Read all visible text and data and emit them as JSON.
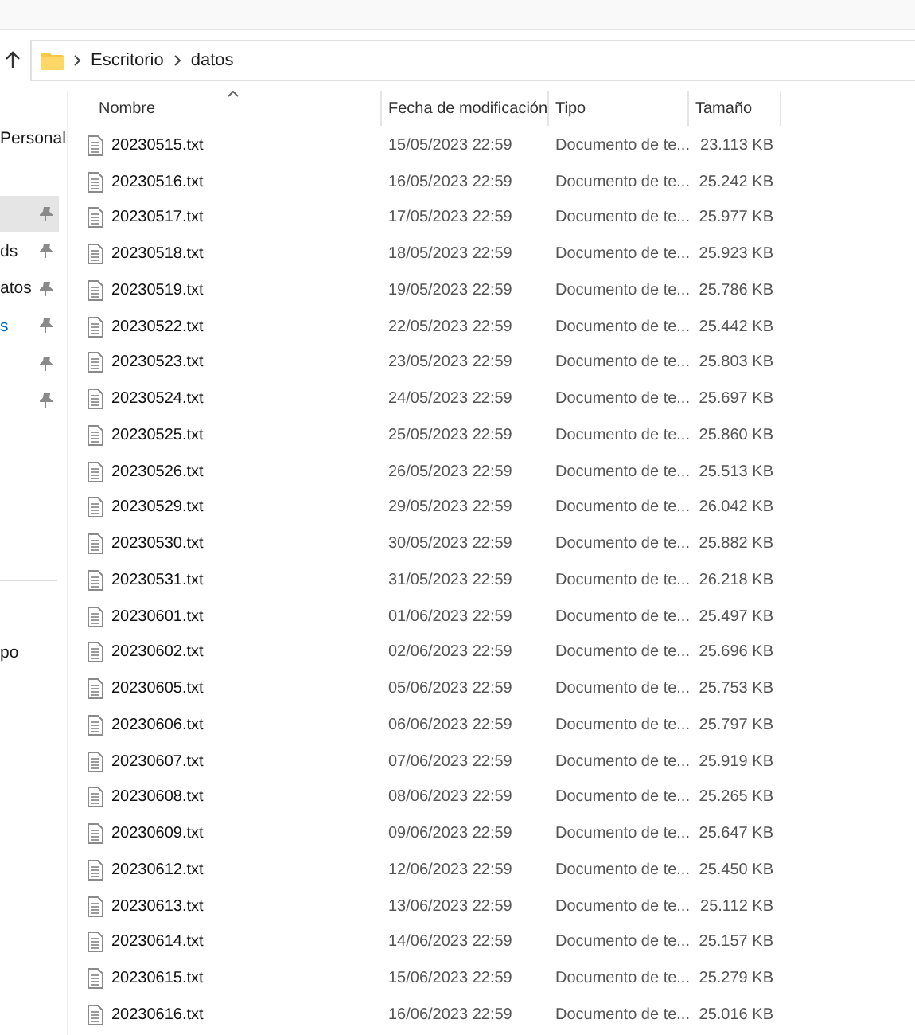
{
  "address": {
    "path": [
      "Escritorio",
      "datos"
    ]
  },
  "sidebar": {
    "groups": [
      {
        "items": [
          {
            "label": "Personal",
            "kind": "text",
            "pinned": false,
            "selected": false
          }
        ]
      },
      {
        "items": [
          {
            "pinned": true,
            "selected": true
          },
          {
            "label": "ds",
            "kind": "text",
            "pinned": true,
            "selected": false
          },
          {
            "label": "atos",
            "kind": "text",
            "pinned": true,
            "selected": false
          },
          {
            "label": "s",
            "kind": "accent",
            "pinned": true,
            "selected": false
          },
          {
            "pinned": true,
            "selected": false
          },
          {
            "pinned": true,
            "selected": false
          }
        ]
      },
      {
        "items": [
          {
            "label": "po",
            "kind": "text",
            "pinned": false,
            "selected": false
          }
        ]
      }
    ]
  },
  "table": {
    "columns": [
      {
        "label": "Nombre",
        "sorted": true
      },
      {
        "label": "Fecha de modificación",
        "sorted": false
      },
      {
        "label": "Tipo",
        "sorted": false
      },
      {
        "label": "Tamaño",
        "sorted": false
      }
    ],
    "rows": [
      {
        "name": "20230515.txt",
        "modified": "15/05/2023 22:59",
        "type": "Documento de te...",
        "size": "23.113 KB"
      },
      {
        "name": "20230516.txt",
        "modified": "16/05/2023 22:59",
        "type": "Documento de te...",
        "size": "25.242 KB"
      },
      {
        "name": "20230517.txt",
        "modified": "17/05/2023 22:59",
        "type": "Documento de te...",
        "size": "25.977 KB"
      },
      {
        "name": "20230518.txt",
        "modified": "18/05/2023 22:59",
        "type": "Documento de te...",
        "size": "25.923 KB"
      },
      {
        "name": "20230519.txt",
        "modified": "19/05/2023 22:59",
        "type": "Documento de te...",
        "size": "25.786 KB"
      },
      {
        "name": "20230522.txt",
        "modified": "22/05/2023 22:59",
        "type": "Documento de te...",
        "size": "25.442 KB"
      },
      {
        "name": "20230523.txt",
        "modified": "23/05/2023 22:59",
        "type": "Documento de te...",
        "size": "25.803 KB"
      },
      {
        "name": "20230524.txt",
        "modified": "24/05/2023 22:59",
        "type": "Documento de te...",
        "size": "25.697 KB"
      },
      {
        "name": "20230525.txt",
        "modified": "25/05/2023 22:59",
        "type": "Documento de te...",
        "size": "25.860 KB"
      },
      {
        "name": "20230526.txt",
        "modified": "26/05/2023 22:59",
        "type": "Documento de te...",
        "size": "25.513 KB"
      },
      {
        "name": "20230529.txt",
        "modified": "29/05/2023 22:59",
        "type": "Documento de te...",
        "size": "26.042 KB"
      },
      {
        "name": "20230530.txt",
        "modified": "30/05/2023 22:59",
        "type": "Documento de te...",
        "size": "25.882 KB"
      },
      {
        "name": "20230531.txt",
        "modified": "31/05/2023 22:59",
        "type": "Documento de te...",
        "size": "26.218 KB"
      },
      {
        "name": "20230601.txt",
        "modified": "01/06/2023 22:59",
        "type": "Documento de te...",
        "size": "25.497 KB"
      },
      {
        "name": "20230602.txt",
        "modified": "02/06/2023 22:59",
        "type": "Documento de te...",
        "size": "25.696 KB"
      },
      {
        "name": "20230605.txt",
        "modified": "05/06/2023 22:59",
        "type": "Documento de te...",
        "size": "25.753 KB"
      },
      {
        "name": "20230606.txt",
        "modified": "06/06/2023 22:59",
        "type": "Documento de te...",
        "size": "25.797 KB"
      },
      {
        "name": "20230607.txt",
        "modified": "07/06/2023 22:59",
        "type": "Documento de te...",
        "size": "25.919 KB"
      },
      {
        "name": "20230608.txt",
        "modified": "08/06/2023 22:59",
        "type": "Documento de te...",
        "size": "25.265 KB"
      },
      {
        "name": "20230609.txt",
        "modified": "09/06/2023 22:59",
        "type": "Documento de te...",
        "size": "25.647 KB"
      },
      {
        "name": "20230612.txt",
        "modified": "12/06/2023 22:59",
        "type": "Documento de te...",
        "size": "25.450 KB"
      },
      {
        "name": "20230613.txt",
        "modified": "13/06/2023 22:59",
        "type": "Documento de te...",
        "size": "25.112 KB"
      },
      {
        "name": "20230614.txt",
        "modified": "14/06/2023 22:59",
        "type": "Documento de te...",
        "size": "25.157 KB"
      },
      {
        "name": "20230615.txt",
        "modified": "15/06/2023 22:59",
        "type": "Documento de te...",
        "size": "25.279 KB"
      },
      {
        "name": "20230616.txt",
        "modified": "16/06/2023 22:59",
        "type": "Documento de te...",
        "size": "25.016 KB"
      }
    ]
  }
}
